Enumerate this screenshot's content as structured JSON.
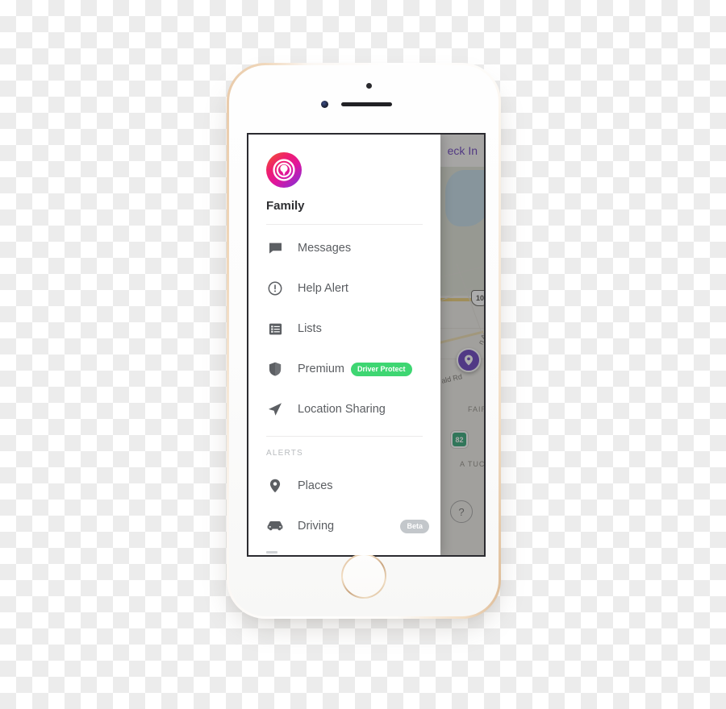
{
  "device": {
    "name": "iphone-gold",
    "frame_color": "#e8c9a8",
    "body_color": "#ffffff"
  },
  "drawer": {
    "logo_icon": "life360-logo-icon",
    "family_name": "Family",
    "menu_items": [
      {
        "icon": "chat-bubble-icon",
        "label": "Messages",
        "badge": null,
        "badge_style": null
      },
      {
        "icon": "exclamation-circle-icon",
        "label": "Help Alert",
        "badge": null,
        "badge_style": null
      },
      {
        "icon": "list-icon",
        "label": "Lists",
        "badge": null,
        "badge_style": null
      },
      {
        "icon": "shield-icon",
        "label": "Premium",
        "badge": "Driver Protect",
        "badge_style": "green"
      },
      {
        "icon": "navigation-arrow-icon",
        "label": "Location Sharing",
        "badge": null,
        "badge_style": null
      }
    ],
    "alerts_section": {
      "title": "ALERTS",
      "items": [
        {
          "icon": "map-pin-icon",
          "label": "Places",
          "badge": null,
          "badge_style": null
        },
        {
          "icon": "car-icon",
          "label": "Driving",
          "badge": "Beta",
          "badge_style": "gray"
        }
      ]
    }
  },
  "map": {
    "checkin_label": "eck In",
    "checkin_color": "#5b2fb5",
    "marker_icon": "location-marker-icon",
    "marker_color": "#5a2fb8",
    "help_button_label": "?",
    "labels": [
      {
        "text": "10",
        "kind": "us-route-shield"
      },
      {
        "text": "82",
        "kind": "state-route-shield"
      },
      {
        "text": "n Ave",
        "kind": "street"
      },
      {
        "text": "ald Rd",
        "kind": "street"
      },
      {
        "text": "FAIR",
        "kind": "area"
      },
      {
        "text": "A TUC",
        "kind": "area"
      }
    ]
  }
}
